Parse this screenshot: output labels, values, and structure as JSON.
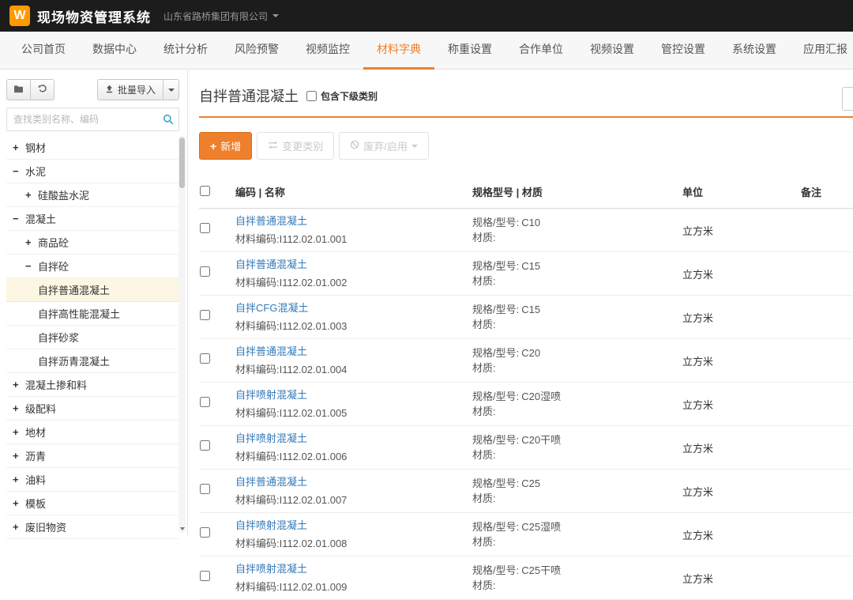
{
  "colors": {
    "accent": "#ee7f2d",
    "logo_orange": "#ff9900",
    "link": "#337ab7",
    "selected_bg": "#fcf6e2"
  },
  "icons": {
    "plus": "+"
  },
  "header": {
    "logo_letter": "W",
    "app_title": "现场物资管理系统",
    "company": "山东省路桥集团有限公司"
  },
  "nav": {
    "items": [
      {
        "label": "公司首页"
      },
      {
        "label": "数据中心"
      },
      {
        "label": "统计分析"
      },
      {
        "label": "风险预警"
      },
      {
        "label": "视频监控"
      },
      {
        "label": "材料字典",
        "active": true
      },
      {
        "label": "称重设置"
      },
      {
        "label": "合作单位"
      },
      {
        "label": "视频设置"
      },
      {
        "label": "管控设置"
      },
      {
        "label": "系统设置"
      },
      {
        "label": "应用汇报"
      }
    ]
  },
  "sidebar": {
    "batch_import_label": "批量导入",
    "search_placeholder": "查找类别名称、编码",
    "tree": [
      {
        "label": "钢材",
        "expand": "+",
        "level": 0
      },
      {
        "label": "水泥",
        "expand": "−",
        "level": 0
      },
      {
        "label": "硅酸盐水泥",
        "expand": "+",
        "level": 1
      },
      {
        "label": "混凝土",
        "expand": "−",
        "level": 0
      },
      {
        "label": "商品砼",
        "expand": "+",
        "level": 1
      },
      {
        "label": "自拌砼",
        "expand": "−",
        "level": 1
      },
      {
        "label": "自拌普通混凝土",
        "expand": "",
        "level": 2,
        "selected": true
      },
      {
        "label": "自拌高性能混凝土",
        "expand": "",
        "level": 2
      },
      {
        "label": "自拌砂浆",
        "expand": "",
        "level": 2
      },
      {
        "label": "自拌沥青混凝土",
        "expand": "",
        "level": 2
      },
      {
        "label": "混凝土掺和料",
        "expand": "+",
        "level": 0
      },
      {
        "label": "级配料",
        "expand": "+",
        "level": 0
      },
      {
        "label": "地材",
        "expand": "+",
        "level": 0
      },
      {
        "label": "沥青",
        "expand": "+",
        "level": 0
      },
      {
        "label": "油料",
        "expand": "+",
        "level": 0
      },
      {
        "label": "模板",
        "expand": "+",
        "level": 0
      },
      {
        "label": "废旧物资",
        "expand": "+",
        "level": 0
      }
    ]
  },
  "main": {
    "title": "自拌普通混凝土",
    "include_sub_label": "包含下级类别",
    "toolbar": {
      "add_label": "新增",
      "change_category_label": "变更类别",
      "discard_enable_label": "废弃/启用"
    },
    "table": {
      "headers": {
        "code_name": "编码 | 名称",
        "spec_material": "规格型号 | 材质",
        "unit": "单位",
        "remark": "备注"
      },
      "labels": {
        "code_prefix": "材料编码:",
        "spec_prefix": "规格/型号:",
        "material_prefix": "材质:"
      },
      "rows": [
        {
          "name": "自拌普通混凝土",
          "code": "I112.02.01.001",
          "spec": "C10",
          "unit": "立方米"
        },
        {
          "name": "自拌普通混凝土",
          "code": "I112.02.01.002",
          "spec": "C15",
          "unit": "立方米"
        },
        {
          "name": "自拌CFG混凝土",
          "code": "I112.02.01.003",
          "spec": "C15",
          "unit": "立方米"
        },
        {
          "name": "自拌普通混凝土",
          "code": "I112.02.01.004",
          "spec": "C20",
          "unit": "立方米"
        },
        {
          "name": "自拌喷射混凝土",
          "code": "I112.02.01.005",
          "spec": "C20湿喷",
          "unit": "立方米"
        },
        {
          "name": "自拌喷射混凝土",
          "code": "I112.02.01.006",
          "spec": "C20干喷",
          "unit": "立方米"
        },
        {
          "name": "自拌普通混凝土",
          "code": "I112.02.01.007",
          "spec": "C25",
          "unit": "立方米"
        },
        {
          "name": "自拌喷射混凝土",
          "code": "I112.02.01.008",
          "spec": "C25湿喷",
          "unit": "立方米"
        },
        {
          "name": "自拌喷射混凝土",
          "code": "I112.02.01.009",
          "spec": "C25干喷",
          "unit": "立方米"
        }
      ]
    }
  }
}
